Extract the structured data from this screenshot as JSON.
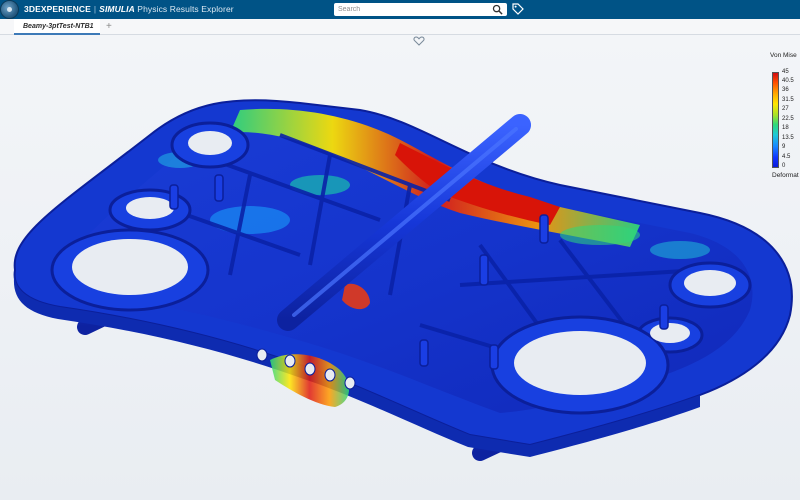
{
  "header": {
    "brand_part1": "3DEXPERIENCE",
    "brand_separator": "|",
    "brand_part2": "SIMULIA",
    "brand_part3": "Physics Results Explorer",
    "search_placeholder": "Search",
    "colors": {
      "topbar": "#005386",
      "tab_accent": "#3d7ab8"
    }
  },
  "tabs": {
    "active_label": "Beamy-3ptTest-NTB1",
    "add_label": "+"
  },
  "icons": [
    "compass-icon",
    "search-icon",
    "tag-icon",
    "heart-icon"
  ],
  "legend": {
    "title": "Von Mise",
    "ticks": [
      "45",
      "40.5",
      "36",
      "31.5",
      "27",
      "22.5",
      "18",
      "13.5",
      "9",
      "4.5",
      "0"
    ],
    "footer": "Deformat",
    "colors": [
      "#d10b10",
      "#ffa800",
      "#ffe600",
      "#2ed97a",
      "#1a88ff",
      "#0b1ad9"
    ]
  }
}
